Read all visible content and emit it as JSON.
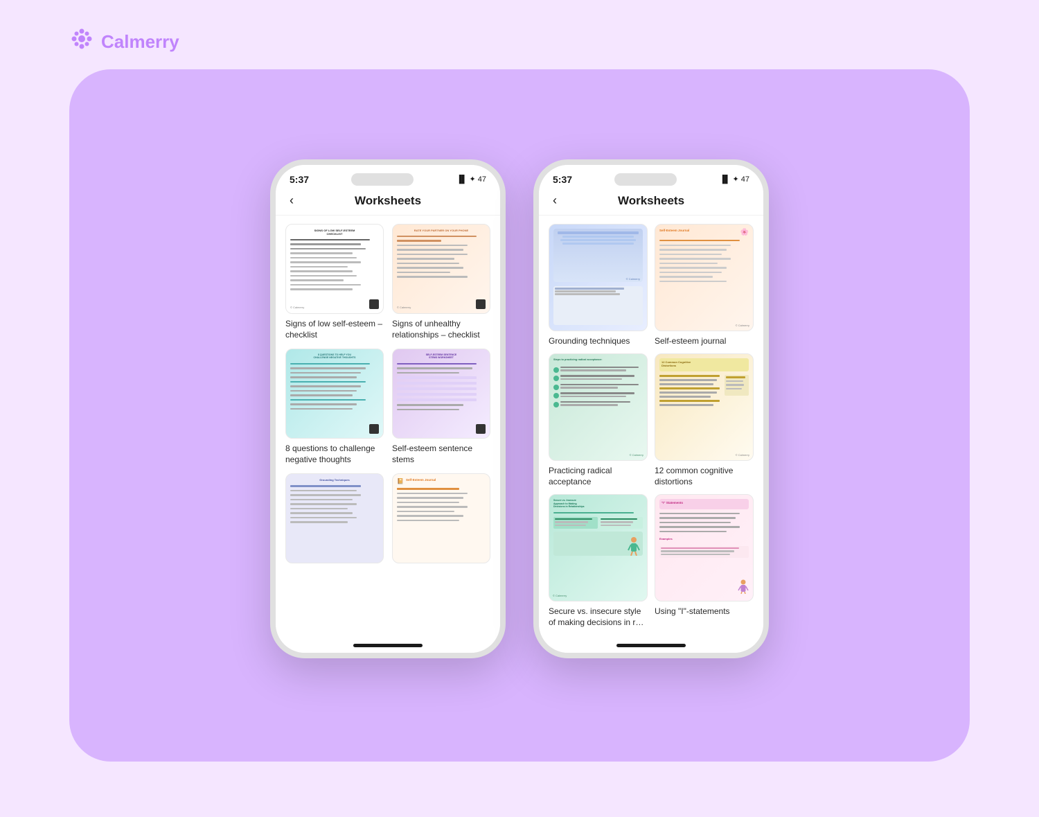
{
  "logo": {
    "text": "Calmerry",
    "icon": "✿"
  },
  "phone_left": {
    "time": "5:37",
    "status": "▋ ✦ 47",
    "title": "Worksheets",
    "worksheets": [
      {
        "id": "signs-self-esteem",
        "label": "Signs of low self-esteem – checklist",
        "thumb_style": "white",
        "title_text": "SIGNS OF LOW SELF-ESTEEM CHECKLIST"
      },
      {
        "id": "signs-unhealthy",
        "label": "Signs of unhealthy relationships – checklist",
        "thumb_style": "peach",
        "title_text": "RATE YOUR PARTNER ON YOUR PHONE"
      },
      {
        "id": "questions-thoughts",
        "label": "8 questions to challenge negative thoughts",
        "thumb_style": "teal",
        "title_text": "8 QUESTIONS TO HELP YOU CHALLENGE NEGATIVE THOUGHTS"
      },
      {
        "id": "selfesteem-stems",
        "label": "Self-esteem sentence stems",
        "thumb_style": "pink",
        "title_text": "SELF-ESTEEM SENTENCE STEMS WORKSHEET"
      },
      {
        "id": "grounding-left",
        "label": "Grounding Techniques",
        "thumb_style": "lavender",
        "title_text": "Grounding Techniques"
      },
      {
        "id": "selfesteem-journal-left",
        "label": "Self-Esteem Journal",
        "thumb_style": "orange",
        "title_text": "Self-Esteem Journal"
      }
    ]
  },
  "phone_right": {
    "time": "5:37",
    "status": "▋ ✦ 47",
    "title": "Worksheets",
    "worksheets": [
      {
        "id": "grounding-techniques",
        "label": "Grounding techniques",
        "thumb_style": "blue-purple"
      },
      {
        "id": "selfesteem-journal",
        "label": "Self-esteem journal",
        "thumb_style": "peach-orange"
      },
      {
        "id": "radical-acceptance",
        "label": "Practicing radical acceptance",
        "thumb_style": "teal-green"
      },
      {
        "id": "cognitive-distortions",
        "label": "12 common cognitive distortions",
        "thumb_style": "yellow-cream"
      },
      {
        "id": "secure-insecure",
        "label": "Secure vs. insecure style of making decisions in r…",
        "thumb_style": "green-teal"
      },
      {
        "id": "i-statements",
        "label": "Using \"I\"-statements",
        "thumb_style": "pink-cream"
      }
    ]
  }
}
